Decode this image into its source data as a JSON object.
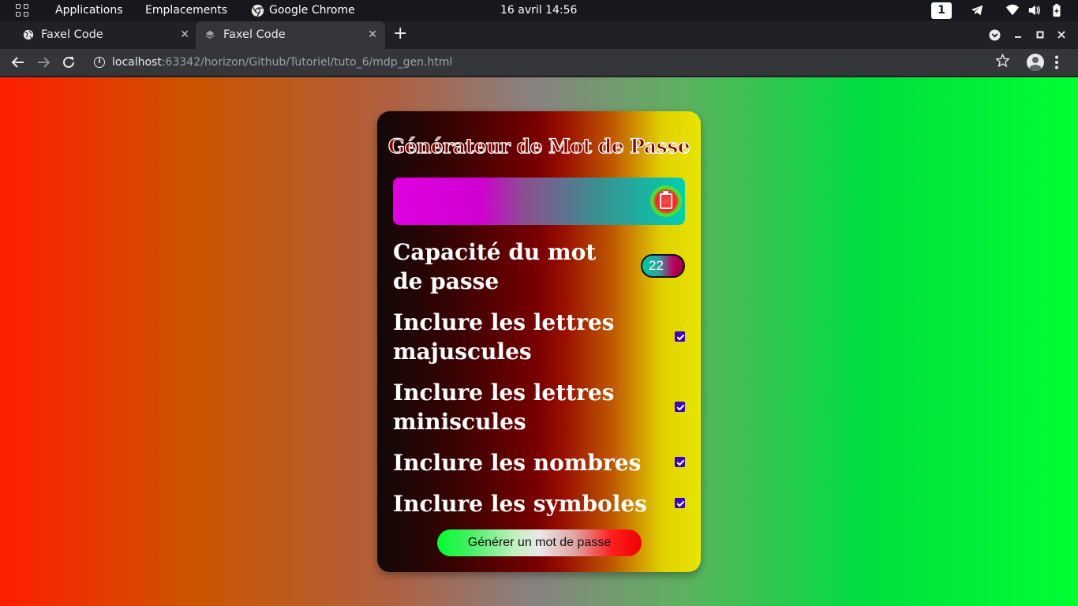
{
  "topbar": {
    "applications": "Applications",
    "places": "Emplacements",
    "active_app": "Google Chrome",
    "clock": "16 avril  14:56",
    "workspace": "1"
  },
  "browser": {
    "tabs": [
      {
        "title": "Faxel Code",
        "close": "✕",
        "active": false
      },
      {
        "title": "Faxel Code",
        "close": "✕",
        "active": true
      }
    ],
    "new_tab": "+",
    "url_host": "localhost",
    "url_rest": ":63342/horizon/Github/Tutoriel/tuto_6/mdp_gen.html",
    "info": "i"
  },
  "app": {
    "title": "Générateur de Mot de Passe",
    "password_value": "",
    "length_label": "Capacité du mot de passe",
    "length_value": "22",
    "options": [
      {
        "label": "Inclure les lettres majuscules",
        "checked": true
      },
      {
        "label": "Inclure les lettres miniscules",
        "checked": true
      },
      {
        "label": "Inclure les nombres",
        "checked": true
      },
      {
        "label": "Inclure les symboles",
        "checked": true
      }
    ],
    "generate_button": "Générer un mot de passe"
  }
}
